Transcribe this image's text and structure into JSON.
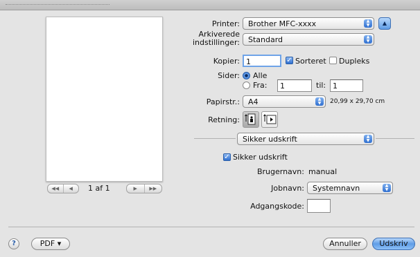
{
  "sheet": {
    "printer_label": "Printer:",
    "printer_value": "Brother MFC-xxxx",
    "presets_label": "Arkiverede indstillinger:",
    "presets_value": "Standard"
  },
  "preview": {
    "page_info": "1 af 1"
  },
  "copies": {
    "label": "Kopier:",
    "value": "1",
    "collated_label": "Sorteret",
    "collated_checked": true,
    "duplex_label": "Dupleks",
    "duplex_checked": false
  },
  "pages": {
    "label": "Sider:",
    "all_label": "Alle",
    "from_label": "Fra:",
    "from_value": "1",
    "to_label": "til:",
    "to_value": "1",
    "selected": "Alle"
  },
  "paper": {
    "label": "Papirstr.:",
    "value": "A4",
    "dims": "20,99 x 29,70 cm"
  },
  "orientation": {
    "label": "Retning:",
    "selected": "portrait"
  },
  "panel": {
    "value": "Sikker udskrift"
  },
  "secure": {
    "checkbox_label": "Sikker udskrift",
    "checked": true,
    "username_label": "Brugernavn:",
    "username_value": "manual",
    "jobname_label": "Jobnavn:",
    "jobname_value": "Systemnavn",
    "password_label": "Adgangskode:",
    "password_value": ""
  },
  "footer": {
    "help_icon": "?",
    "pdf_label": "PDF ▾",
    "cancel_label": "Annuller",
    "print_label": "Udskriv"
  },
  "colors": {
    "accent": "#2f6fd0",
    "default_button": "#5f9de6"
  }
}
